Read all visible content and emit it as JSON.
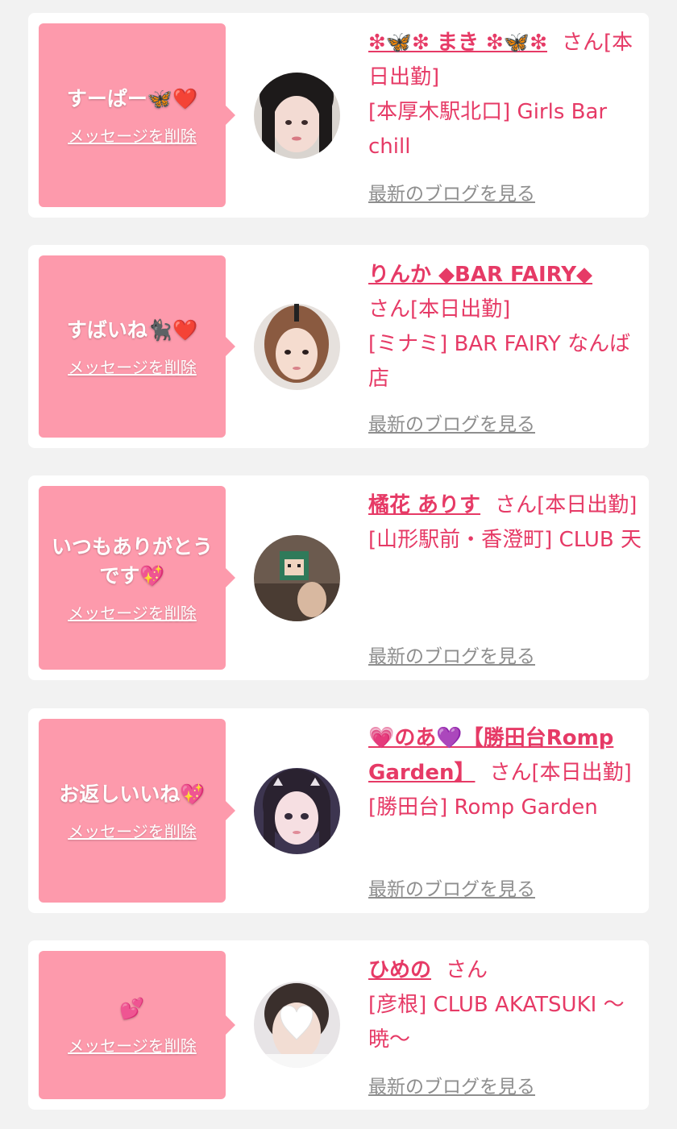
{
  "delete_label": "メッセージを削除",
  "blog_label": "最新のブログを見る",
  "colors": {
    "accent": "#e63a66",
    "bubble": "#fd9aac",
    "link_gray": "#8e8e8e",
    "background": "#f2f2f2"
  },
  "cards": [
    {
      "message": "すーぱー🦋❤️",
      "name": "❇︎🦋❇︎ まき ❇︎🦋❇︎",
      "suffix": "さん[本日出勤]",
      "shop": "[本厚木駅北口] Girls Bar chill"
    },
    {
      "message": "すばいね🐈‍⬛❤️",
      "name": "りんか ◆BAR FAIRY◆",
      "suffix": "さん[本日出勤]",
      "shop": "[ミナミ] BAR FAIRY なんば店"
    },
    {
      "message": "いつもありがとうです💖",
      "name": "橘花 ありす",
      "suffix": "さん[本日出勤]",
      "shop": "[山形駅前・香澄町] CLUB 天"
    },
    {
      "message": "お返しいいね💖",
      "name": "💗のあ💜【勝田台Romp Garden】",
      "suffix": "さん[本日出勤]",
      "shop": "[勝田台] Romp Garden"
    },
    {
      "message": "💕",
      "name": "ひめの",
      "suffix": "さん",
      "shop": "[彦根] CLUB AKATSUKI 〜暁〜"
    }
  ]
}
